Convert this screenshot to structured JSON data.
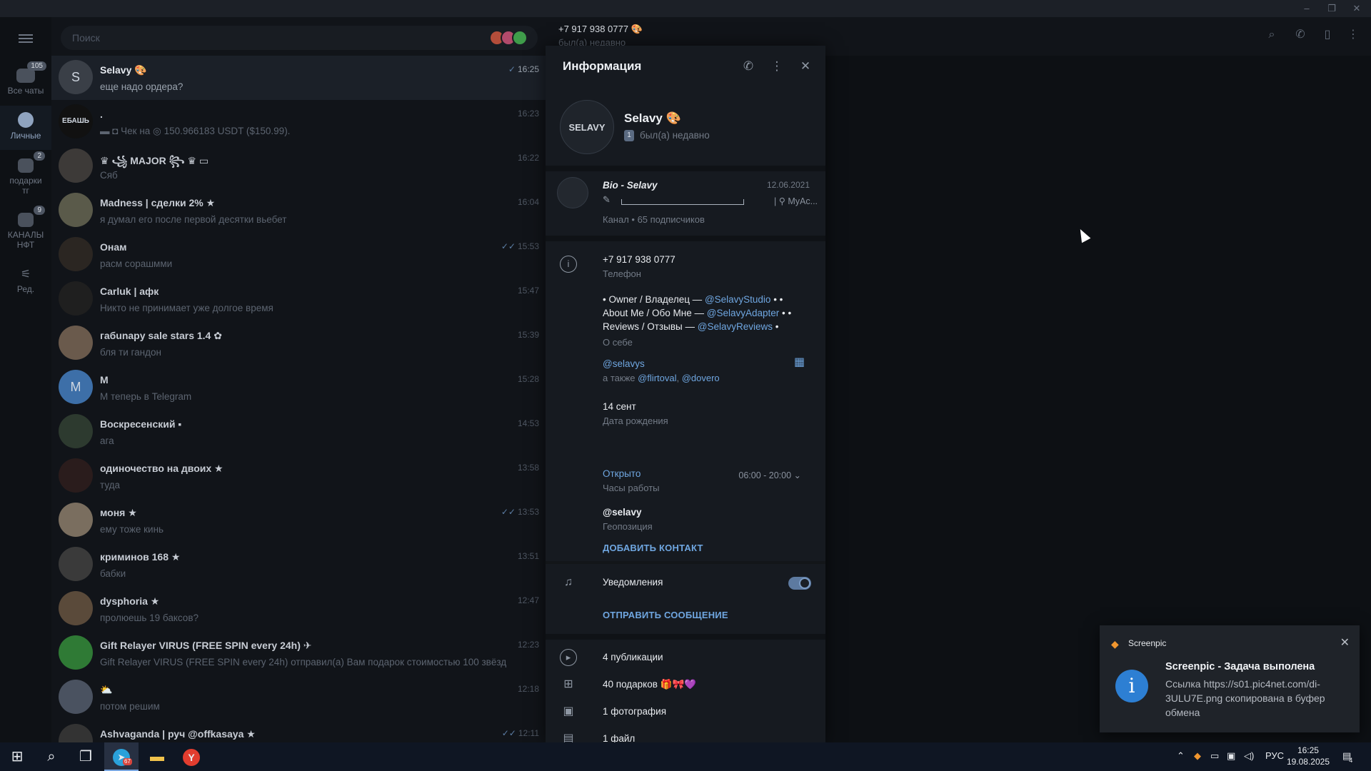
{
  "window": {
    "minimize": "–",
    "maximize": "❐",
    "close": "✕"
  },
  "rail": {
    "items": [
      {
        "label": "Все чаты",
        "badge": "105"
      },
      {
        "label": "Личные",
        "badge": ""
      },
      {
        "label": "подарки тг",
        "badge": "2"
      },
      {
        "label": "КАНАЛЫ НФТ",
        "badge": "9"
      },
      {
        "label": "Ред.",
        "badge": ""
      }
    ]
  },
  "search": {
    "placeholder": "Поиск"
  },
  "chats": [
    {
      "name": "Selavy 🎨",
      "msg": "еще надо ордера?",
      "time": "16:25",
      "check": "✓",
      "avatar": "S",
      "color": "#3a3f47"
    },
    {
      "name": ".",
      "msg": "▬ ◘ Чек на ◎ 150.966183 USDT ($150.99).",
      "time": "16:23",
      "check": "",
      "avatar": "ЕБАШЬ",
      "color": "#111111"
    },
    {
      "name": "♛ ꧁ MAJOR ꧂ ♛ ▭",
      "msg": "Сяб",
      "time": "16:22",
      "check": "",
      "avatar": "",
      "color": "#3d3a38"
    },
    {
      "name": "Madness | сделки 2% ★",
      "msg": "я думал его после первой десятки вьебет",
      "time": "16:04",
      "check": "",
      "avatar": "",
      "color": "#5a5a4a"
    },
    {
      "name": "Онам",
      "msg": "расм сорашмми",
      "time": "15:53",
      "check": "✓✓",
      "avatar": "",
      "color": "#2b2622"
    },
    {
      "name": "Carluk | афк",
      "msg": "Никто не принимает уже долгое время",
      "time": "15:47",
      "check": "",
      "avatar": "",
      "color": "#1f1f1f"
    },
    {
      "name": "габunapy sale stars 1.4 ✿",
      "msg": "бля ти гандон",
      "time": "15:39",
      "check": "",
      "avatar": "",
      "color": "#6a5a4c"
    },
    {
      "name": "M",
      "msg": "M теперь в Telegram",
      "time": "15:28",
      "check": "",
      "avatar": "M",
      "color": "#3d6fa8"
    },
    {
      "name": "Воскресенский ▪",
      "msg": "ага",
      "time": "14:53",
      "check": "",
      "avatar": "",
      "color": "#2d3a2f"
    },
    {
      "name": "одиночество на двоих ★",
      "msg": "туда",
      "time": "13:58",
      "check": "",
      "avatar": "",
      "color": "#2a1c1c"
    },
    {
      "name": "моня ★",
      "msg": "ему тоже кинь",
      "time": "13:53",
      "check": "✓✓",
      "avatar": "",
      "color": "#7a6e5f"
    },
    {
      "name": "криминов 168 ★",
      "msg": "бабки",
      "time": "13:51",
      "check": "",
      "avatar": "",
      "color": "#3a3a3a"
    },
    {
      "name": "dysphoria ★",
      "msg": "пролюешь 19 баксов?",
      "time": "12:47",
      "check": "",
      "avatar": "",
      "color": "#5a4a3a"
    },
    {
      "name": "Gift Relayer VIRUS (FREE SPIN every 24h) ✈",
      "msg": "Gift Relayer VIRUS (FREE SPIN every 24h) отправил(а) Вам подарок стоимостью 100 звёзд",
      "time": "12:23",
      "check": "",
      "avatar": "",
      "color": "#2f7a35"
    },
    {
      "name": "⛅",
      "msg": "потом решим",
      "time": "12:18",
      "check": "",
      "avatar": "",
      "color": "#4a5260"
    },
    {
      "name": "Ashvaganda | руч @offkasaya ★",
      "msg": "",
      "time": "12:11",
      "check": "✓✓",
      "avatar": "",
      "color": "#333333"
    }
  ],
  "header": {
    "name": "+7 917 938 0777 🎨",
    "status": "был(а) недавно"
  },
  "info": {
    "title": "Информация",
    "avatar_text": "SELAVY",
    "name": "Selavy 🎨",
    "badge": "1",
    "status": "был(а) недавно",
    "channel": {
      "title": "Bio - Selavy",
      "date": "12.06.2021",
      "snippet": "| ⚲ MyAc...",
      "sub": "Канал • 65 подписчиков"
    },
    "phone": {
      "value": "+7 917 938 0777",
      "label": "Телефон"
    },
    "bio": {
      "p1": "• Owner / Владелец — ",
      "l1": "@SelavyStudio",
      "p2": " • • About Me / Обо Мне — ",
      "l2": "@SelavyAdapter",
      "p3": " • • Reviews / Отзывы — ",
      "l3": "@SelavyReviews",
      "p4": " •",
      "label": "О себе"
    },
    "username": {
      "value": "@selavys",
      "also": "а также ",
      "u2": "@flirtoval",
      "sep": ", ",
      "u3": "@dovero"
    },
    "birthday": {
      "value": "14 сент",
      "label": "Дата рождения"
    },
    "hours": {
      "value": "Открыто",
      "label": "Часы работы",
      "range": "06:00 - 20:00 ⌄"
    },
    "geo": {
      "value": "@selavy",
      "label": "Геопозиция"
    },
    "add_contact": "ДОБАВИТЬ КОНТАКТ",
    "notifications": {
      "label": "Уведомления",
      "on": true
    },
    "send_message": "ОТПРАВИТЬ СООБЩЕНИЕ",
    "media": [
      {
        "icon": "play-circle-icon",
        "label": "4 публикации"
      },
      {
        "icon": "gift-icon",
        "label": "40 подарков 🎁🎀💜"
      },
      {
        "icon": "photo-icon",
        "label": "1 фотография"
      },
      {
        "icon": "file-icon",
        "label": "1 файл"
      }
    ]
  },
  "toast": {
    "app": "Screenpic",
    "title": "Screenpic - Задача выполена",
    "body": "Ссылка https://s01.pic4net.com/di-3ULU7E.png скопирована в буфер обмена"
  },
  "taskbar": {
    "lang": "РУС",
    "time": "16:25",
    "date": "19.08.2025",
    "notif_count": "4",
    "telegram_badge": "67"
  }
}
